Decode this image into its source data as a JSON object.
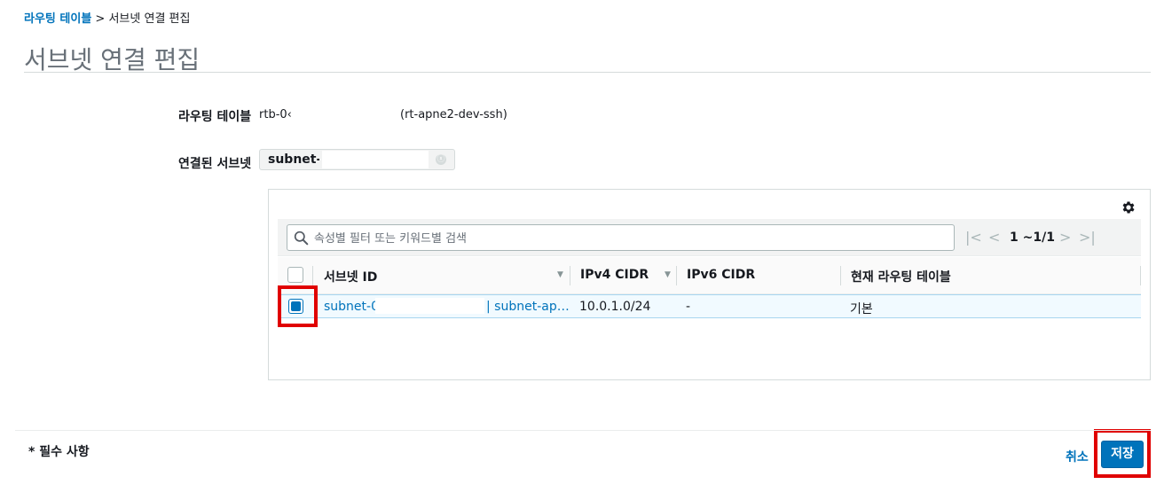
{
  "breadcrumb": {
    "parent": "라우팅 테이블",
    "separator": " > ",
    "current": "서브넷 연결 편집"
  },
  "page_title": "서브넷 연결 편집",
  "form": {
    "route_table_label": "라우팅 테이블",
    "route_table_id": "rtb-0‹",
    "route_table_name": "(rt-apne2-dev-ssh)",
    "associated_subnets_label": "연결된 서브넷",
    "selected_token": "subnet-0‹",
    "token_clear_icon": "ⓧ"
  },
  "table": {
    "settings_icon": "gear-icon",
    "search_placeholder": "속성별 필터 또는 키워드별 검색",
    "search_value": "",
    "pagination": {
      "first": "|<",
      "prev": "<",
      "text": "1 ~1/1",
      "next": ">",
      "last": ">|"
    },
    "columns": [
      "서브넷 ID",
      "IPv4 CIDR",
      "IPv6 CIDR",
      "현재 라우팅 테이블"
    ],
    "rows": [
      {
        "selected": true,
        "subnet_id": "subnet-0‹",
        "subnet_name": "| subnet-ap…",
        "ipv4": "10.0.1.0/24",
        "ipv6": "-",
        "route_table": "기본"
      }
    ]
  },
  "footer": {
    "required_note": "* 필수 사항",
    "cancel_label": "취소",
    "save_label": "저장"
  },
  "colors": {
    "accent": "#0073bb",
    "highlight": "#e00000",
    "selected_row": "#f1faff"
  }
}
